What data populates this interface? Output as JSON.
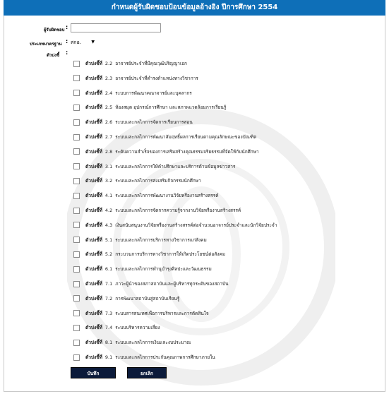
{
  "title": "กำหนดผู้รับผิดชอบป้อนข้อมูลอ้างอิง ปีการศึกษา 2554",
  "form": {
    "user_label": "ผู้รับผิดชอบ",
    "user_value": "",
    "standard_label": "ประเภทมาตรฐาน",
    "standard_value": "สกอ.",
    "indicator_label": "ตัวบ่งชี้",
    "colon": ":"
  },
  "indicators": [
    {
      "prefix": "ตัวบ่งชี้ที่",
      "code": "2.2",
      "text": "อาจารย์ประจำที่มีคุณวุฒิปริญญาเอก"
    },
    {
      "prefix": "ตัวบ่งชี้ที่",
      "code": "2.3",
      "text": "อาจารย์ประจำที่ดำรงตำแหน่งทางวิชาการ"
    },
    {
      "prefix": "ตัวบ่งชี้ที่",
      "code": "2.4",
      "text": "ระบบการพัฒนาคณาจารย์และบุคลากร"
    },
    {
      "prefix": "ตัวบ่งชี้ที่",
      "code": "2.5",
      "text": "ห้องสมุด  อุปกรณ์การศึกษา  และสภาพแวดล้อมการเรียนรู้"
    },
    {
      "prefix": "ตัวบ่งชี้ที่",
      "code": "2.6",
      "text": "ระบบและกลไกการจัดการเรียนการสอน"
    },
    {
      "prefix": "ตัวบ่งชี้ที่",
      "code": "2.7",
      "text": "ระบบและกลไกการพัฒนาสัมฤทธิ์ผลการเรียนตามคุณลักษณะของบัณฑิต"
    },
    {
      "prefix": "ตัวบ่งชี้ที่",
      "code": "2.8",
      "text": "ระดับความสำเร็จของการเสริมสร้างคุณธรรมจริยธรรมที่จัดให้กับนักศึกษา"
    },
    {
      "prefix": "ตัวบ่งชี้ที่",
      "code": "3.1",
      "text": "ระบบและกลไกการให้คำปรึกษาและบริการด้านข้อมูลข่าวสาร"
    },
    {
      "prefix": "ตัวบ่งชี้ที่",
      "code": "3.2",
      "text": "ระบบและกลไกการส่งเสริมกิจกรรมนักศึกษา"
    },
    {
      "prefix": "ตัวบ่งชี้ที่",
      "code": "4.1",
      "text": "ระบบและกลไกการพัฒนางานวิจัยหรืองานสร้างสรรค์"
    },
    {
      "prefix": "ตัวบ่งชี้ที่",
      "code": "4.2",
      "text": "ระบบและกลไกการจัดการความรู้จากงานวิจัยหรืองานสร้างสรรค์"
    },
    {
      "prefix": "ตัวบ่งชี้ที่",
      "code": "4.3",
      "text": "เงินสนับสนุนงานวิจัยหรืองานสร้างสรรค์ต่อจำนวนอาจารย์ประจำและนักวิจัยประจำ"
    },
    {
      "prefix": "ตัวบ่งชี้ที่",
      "code": "5.1",
      "text": "ระบบและกลไกการบริการทางวิชาการแก่สังคม"
    },
    {
      "prefix": "ตัวบ่งชี้ที่",
      "code": "5.2",
      "text": "กระบวนการบริการทางวิชาการให้เกิดประโยชน์ต่อสังคม"
    },
    {
      "prefix": "ตัวบ่งชี้ที่",
      "code": "6.1",
      "text": "ระบบและกลไกการทำนุบำรุงศิลปะและวัฒนธรรม"
    },
    {
      "prefix": "ตัวบ่งชี้ที่",
      "code": "7.1",
      "text": "ภาวะผู้นำของสภาสถาบันและผู้บริหารทุกระดับของสถาบัน"
    },
    {
      "prefix": "ตัวบ่งชี้ที่",
      "code": "7.2",
      "text": "การพัฒนาสถาบันสู่สถาบันเรียนรู้"
    },
    {
      "prefix": "ตัวบ่งชี้ที่",
      "code": "7.3",
      "text": "ระบบสารสนเทศเพื่อการบริหารและการตัดสินใจ"
    },
    {
      "prefix": "ตัวบ่งชี้ที่",
      "code": "7.4",
      "text": "ระบบบริหารความเสี่ยง"
    },
    {
      "prefix": "ตัวบ่งชี้ที่",
      "code": "8.1",
      "text": "ระบบและกลไกการเงินและงบประมาณ"
    },
    {
      "prefix": "ตัวบ่งชี้ที่",
      "code": "9.1",
      "text": "ระบบและกลไกการประกันคุณภาพการศึกษาภายใน"
    }
  ],
  "buttons": {
    "save": "บันทึก",
    "cancel": "ยกเลิก"
  },
  "colors": {
    "title_bar": "#0e6fb8",
    "button": "#0b1a3a"
  }
}
